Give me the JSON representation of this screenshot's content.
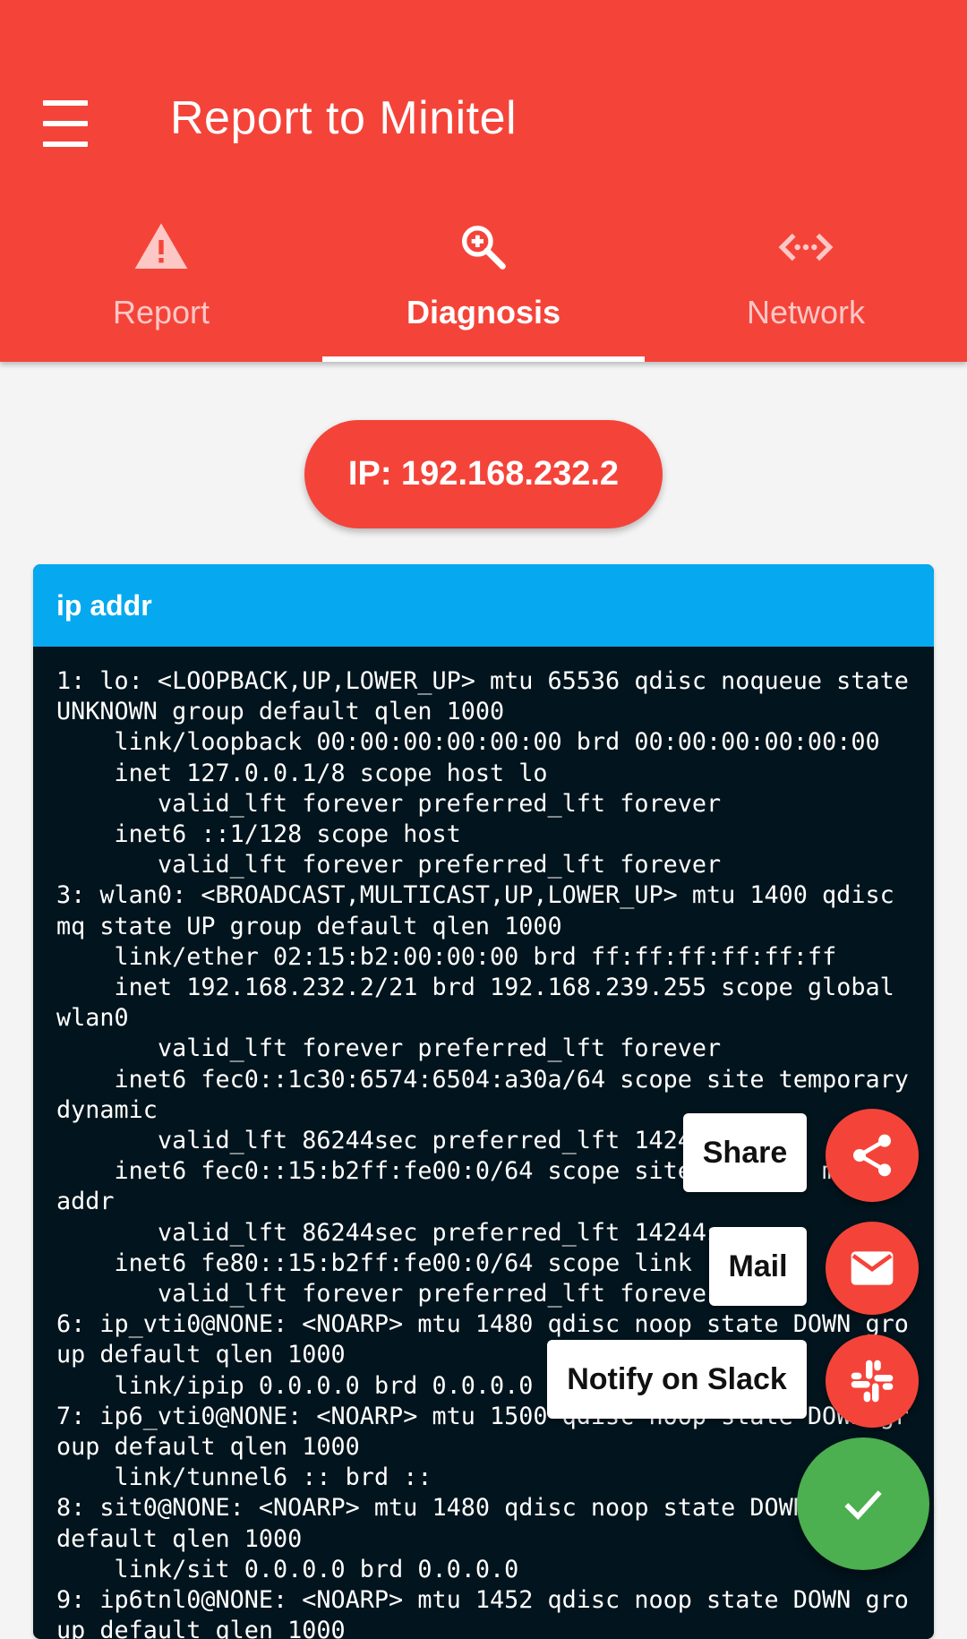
{
  "app": {
    "title": "Report to Minitel"
  },
  "tabs": [
    {
      "label": "Report",
      "icon": "warning-icon"
    },
    {
      "label": "Diagnosis",
      "icon": "zoom-in-icon"
    },
    {
      "label": "Network",
      "icon": "settings-ethernet-icon"
    }
  ],
  "ip_button": {
    "label": "IP: 192.168.232.2"
  },
  "card": {
    "title": "ip addr",
    "output": "1: lo: <LOOPBACK,UP,LOWER_UP> mtu 65536 qdisc noqueue state UNKNOWN group default qlen 1000\n    link/loopback 00:00:00:00:00:00 brd 00:00:00:00:00:00\n    inet 127.0.0.1/8 scope host lo\n       valid_lft forever preferred_lft forever\n    inet6 ::1/128 scope host\n       valid_lft forever preferred_lft forever\n3: wlan0: <BROADCAST,MULTICAST,UP,LOWER_UP> mtu 1400 qdisc mq state UP group default qlen 1000\n    link/ether 02:15:b2:00:00:00 brd ff:ff:ff:ff:ff:ff\n    inet 192.168.232.2/21 brd 192.168.239.255 scope global wlan0\n       valid_lft forever preferred_lft forever\n    inet6 fec0::1c30:6574:6504:a30a/64 scope site temporary dynamic\n       valid_lft 86244sec preferred_lft 14244sec\n    inet6 fec0::15:b2ff:fe00:0/64 scope site dynamic mngtmpaddr\n       valid_lft 86244sec preferred_lft 14244sec\n    inet6 fe80::15:b2ff:fe00:0/64 scope link\n       valid_lft forever preferred_lft forever\n6: ip_vti0@NONE: <NOARP> mtu 1480 qdisc noop state DOWN group default qlen 1000\n    link/ipip 0.0.0.0 brd 0.0.0.0\n7: ip6_vti0@NONE: <NOARP> mtu 1500 qdisc noop state DOWN group default qlen 1000\n    link/tunnel6 :: brd ::\n8: sit0@NONE: <NOARP> mtu 1480 qdisc noop state DOWN group default qlen 1000\n    link/sit 0.0.0.0 brd 0.0.0.0\n9: ip6tnl0@NONE: <NOARP> mtu 1452 qdisc noop state DOWN group default qlen 1000"
  },
  "speed_dial": {
    "share_label": "Share",
    "mail_label": "Mail",
    "slack_label": "Notify on Slack"
  },
  "colors": {
    "primary": "#f4443a",
    "card_header": "#06a9ef",
    "terminal_bg": "#02141d",
    "confirm": "#4caf50"
  }
}
